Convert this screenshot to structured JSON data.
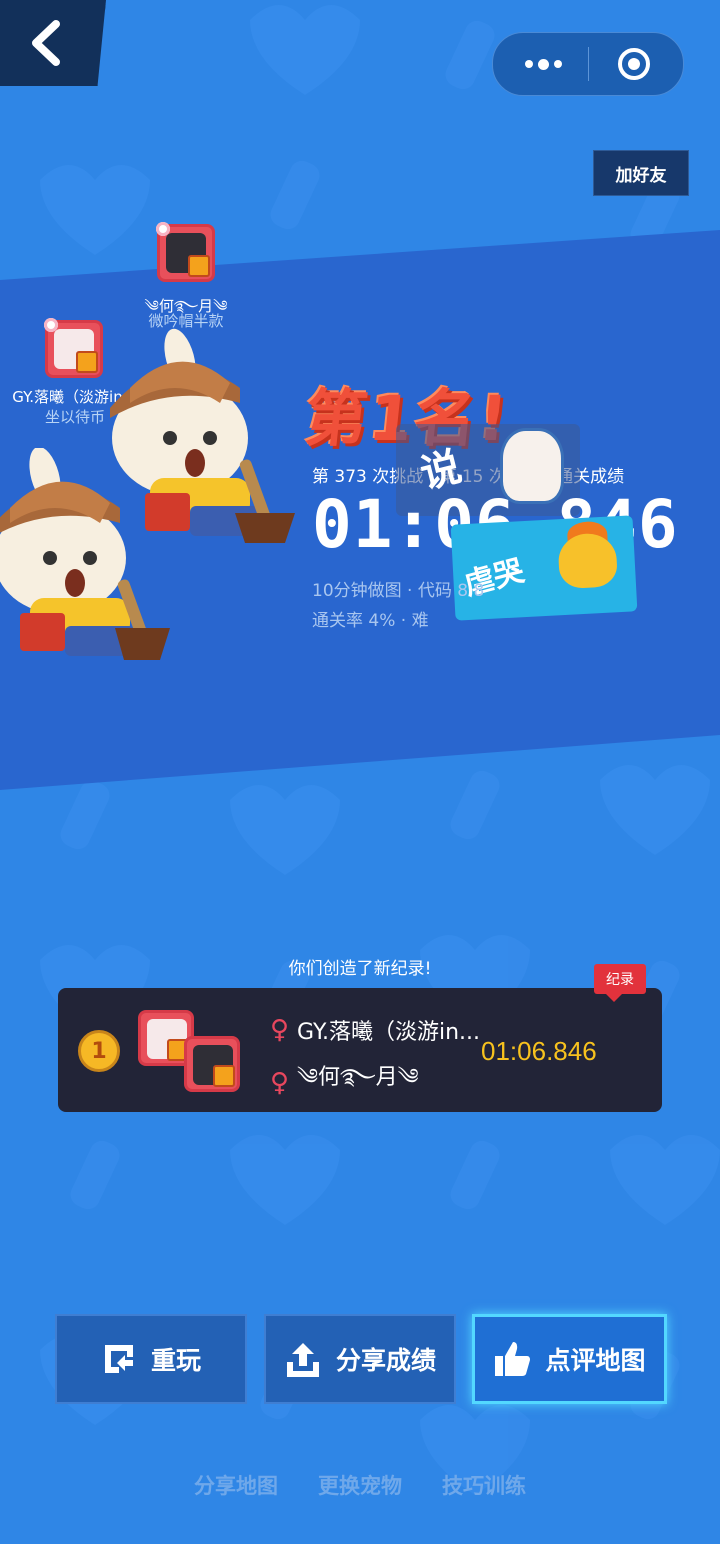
{
  "colors": {
    "background": "#2f86e6",
    "band": "#2966cf",
    "record_time": "#f7c21e",
    "accent_red": "#e2323c"
  },
  "header": {
    "back_icon": "chevron-left-icon",
    "menu_icon": "more-dots-icon",
    "close_icon": "target-icon",
    "add_friend": "加好友"
  },
  "players": [
    {
      "name": "༄何࿐月༄",
      "subtitle": "微吟帽半款"
    },
    {
      "name": "GY.落曦（淡游in…",
      "subtitle": "坐以待币"
    }
  ],
  "result": {
    "rank_title": "第1名!",
    "challenge_line": "第 373 次挑战 · 第 15 次通关 · 通关成绩",
    "time": "01:06.846",
    "meta_line1": "10分钟做图 · 代码 8 8",
    "meta_line2": "通关率 4% · 难",
    "sticker_say": "说",
    "sticker_cry": "虐哭"
  },
  "record": {
    "headline": "你们创造了新纪录!",
    "tag": "纪录",
    "rank": "1",
    "player1": "GY.落曦（淡游in...",
    "player2": "༄何࿐月༄",
    "gender_symbol": "♀",
    "time": "01:06.846"
  },
  "actions": [
    {
      "label": "重玩",
      "icon": "replay-icon"
    },
    {
      "label": "分享成绩",
      "icon": "upload-share-icon"
    },
    {
      "label": "点评地图",
      "icon": "thumbs-up-icon"
    }
  ],
  "links": [
    "分享地图",
    "更换宠物",
    "技巧训练"
  ]
}
